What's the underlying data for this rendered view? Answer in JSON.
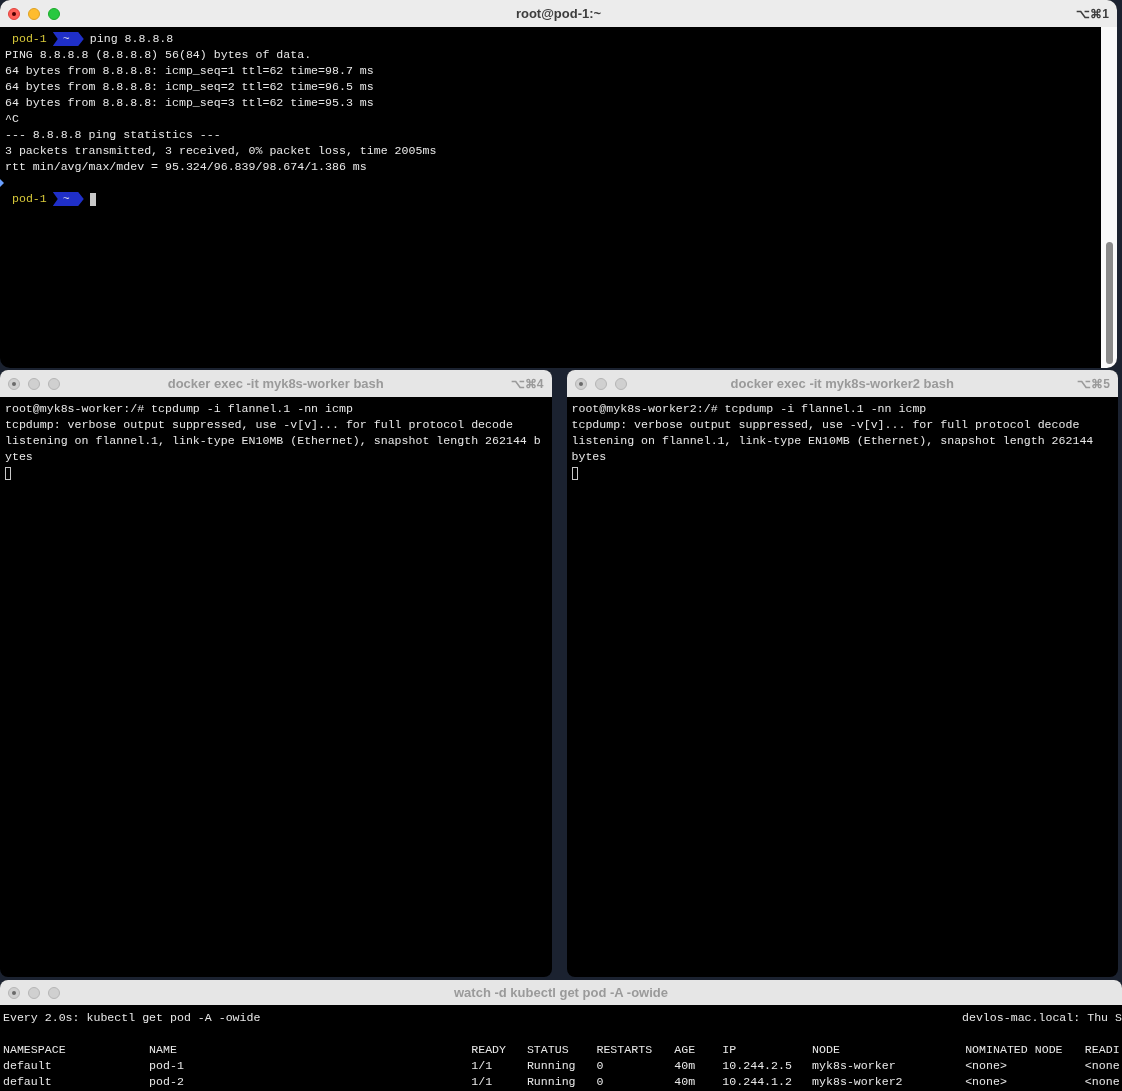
{
  "top_window": {
    "title": "root@pod-1:~",
    "shortcut": "⌥⌘1",
    "active": true,
    "lines": [
      {
        "kind": "prompt",
        "host": "pod-1",
        "dir": "~",
        "command": "ping 8.8.8.8"
      },
      {
        "kind": "output",
        "text": "PING 8.8.8.8 (8.8.8.8) 56(84) bytes of data."
      },
      {
        "kind": "output",
        "text": "64 bytes from 8.8.8.8: icmp_seq=1 ttl=62 time=98.7 ms"
      },
      {
        "kind": "output",
        "text": "64 bytes from 8.8.8.8: icmp_seq=2 ttl=62 time=96.5 ms"
      },
      {
        "kind": "output",
        "text": "64 bytes from 8.8.8.8: icmp_seq=3 ttl=62 time=95.3 ms"
      },
      {
        "kind": "output",
        "text": "^C"
      },
      {
        "kind": "output",
        "text": "--- 8.8.8.8 ping statistics ---"
      },
      {
        "kind": "output",
        "text": "3 packets transmitted, 3 received, 0% packet loss, time 2005ms"
      },
      {
        "kind": "output",
        "text": "rtt min/avg/max/mdev = 95.324/96.839/98.674/1.386 ms"
      },
      {
        "kind": "blank"
      },
      {
        "kind": "prompt",
        "host": "pod-1",
        "dir": "~"
      }
    ]
  },
  "side_windows": [
    {
      "title": "docker exec -it myk8s-worker bash",
      "shortcut": "⌥⌘4",
      "active": false,
      "lines": [
        {
          "kind": "output",
          "text": "root@myk8s-worker:/# tcpdump -i flannel.1 -nn icmp"
        },
        {
          "kind": "output",
          "text": "tcpdump: verbose output suppressed, use -v[v]... for full protocol decode"
        },
        {
          "kind": "output",
          "text": "listening on flannel.1, link-type EN10MB (Ethernet), snapshot length 262144 b"
        },
        {
          "kind": "output",
          "text": "ytes"
        },
        {
          "kind": "cursor"
        }
      ]
    },
    {
      "title": "docker exec -it myk8s-worker2 bash",
      "shortcut": "⌥⌘5",
      "active": false,
      "lines": [
        {
          "kind": "output",
          "text": "root@myk8s-worker2:/# tcpdump -i flannel.1 -nn icmp"
        },
        {
          "kind": "output",
          "text": "tcpdump: verbose output suppressed, use -v[v]... for full protocol decode"
        },
        {
          "kind": "output",
          "text": "listening on flannel.1, link-type EN10MB (Ethernet), snapshot length 262144"
        },
        {
          "kind": "output",
          "text": "bytes"
        },
        {
          "kind": "cursor"
        }
      ]
    }
  ],
  "watch_window": {
    "title": "watch -d kubectl get pod -A -owide",
    "active": false,
    "header_left": "Every 2.0s: kubectl get pod -A -owide",
    "header_right": "devlos-mac.local: Thu S",
    "table": {
      "columns": [
        "NAMESPACE",
        "NAME",
        "READY",
        "STATUS",
        "RESTARTS",
        "AGE",
        "IP",
        "NODE",
        "NOMINATED NODE",
        "READI"
      ],
      "rows": [
        [
          "default",
          "pod-1",
          "1/1",
          "Running",
          "0",
          "40m",
          "10.244.2.5",
          "myk8s-worker",
          "<none>",
          "<none"
        ],
        [
          "default",
          "pod-2",
          "1/1",
          "Running",
          "0",
          "40m",
          "10.244.1.2",
          "myk8s-worker2",
          "<none>",
          "<none"
        ]
      ]
    }
  }
}
